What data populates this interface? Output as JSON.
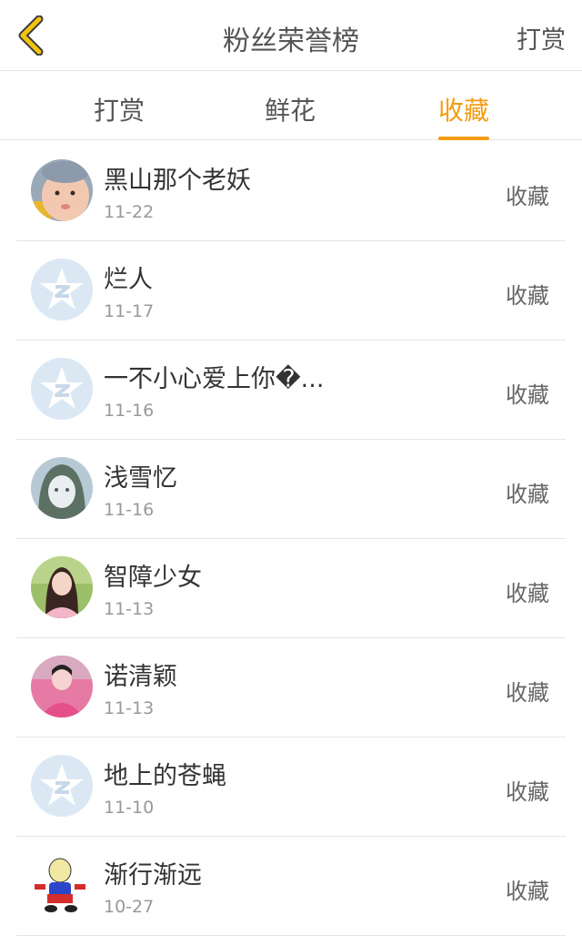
{
  "header": {
    "back_icon": "chevron-left-icon",
    "title": "粉丝荣誉榜",
    "right_action": "打赏"
  },
  "tabs": [
    {
      "label": "打赏",
      "active": false
    },
    {
      "label": "鲜花",
      "active": false
    },
    {
      "label": "收藏",
      "active": true
    }
  ],
  "colors": {
    "accent": "#f39c12",
    "back_icon": "#f1c40f"
  },
  "fans": [
    {
      "name": "黑山那个老妖",
      "date": "11-22",
      "action": "收藏",
      "avatar": "baby-photo"
    },
    {
      "name": "烂人",
      "date": "11-17",
      "action": "收藏",
      "avatar": "default-star-avatar"
    },
    {
      "name": "一不小心爱上你�...",
      "date": "11-16",
      "action": "收藏",
      "avatar": "default-star-avatar"
    },
    {
      "name": "浅雪忆",
      "date": "11-16",
      "action": "收藏",
      "avatar": "anime-girl"
    },
    {
      "name": "智障少女",
      "date": "11-13",
      "action": "收藏",
      "avatar": "girl-photo"
    },
    {
      "name": "诺清颖",
      "date": "11-13",
      "action": "收藏",
      "avatar": "pink-girl-photo"
    },
    {
      "name": "地上的苍蝇",
      "date": "11-10",
      "action": "收藏",
      "avatar": "default-star-avatar"
    },
    {
      "name": "渐行渐远",
      "date": "10-27",
      "action": "收藏",
      "avatar": "cartoon-boy"
    }
  ]
}
